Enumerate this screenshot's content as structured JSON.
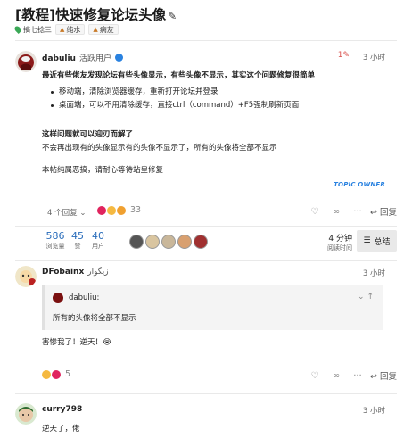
{
  "topic": {
    "title": "[教程]快速修复论坛头像",
    "category": "搞七捻三",
    "tags": [
      "纯水",
      "病友"
    ]
  },
  "posts": [
    {
      "username": "dabuliu",
      "user_title": "活跃用户",
      "time": "3 小时",
      "heading": "最近有些佬友发现论坛有些头像显示，有些头像不显示，其实这个问题修复很简单",
      "bullets": [
        "移动端，清除浏览器缓存，重新打开论坛并登录",
        "桌面端，可以不用清除缓存，直接ctrl（command）+F5强制刷新页面"
      ],
      "subheading": "这样问题就可以迎刃而解了",
      "para1": "不会再出现有的头像显示有的头像不显示了，所有的头像将全部不显示",
      "para2": "本帖纯属恶搞，请耐心等待站皇修复",
      "badge": "TOPIC OWNER",
      "replies_label": "4 个回复",
      "reaction_count": "33",
      "reply_label": "回复"
    },
    {
      "username": "DFobainx",
      "display_name": "زیگوار",
      "time": "3 小时",
      "quote_user": "dabuliu:",
      "quote_text": "所有的头像将全部不显示",
      "text": "害惨我了！逆天！😭",
      "reaction_count": "5",
      "reply_label": "回复"
    },
    {
      "username": "curry798",
      "time": "3 小时",
      "text": "逆天了，佬"
    }
  ],
  "summary": {
    "views": "586",
    "views_label": "浏览量",
    "likes": "45",
    "likes_label": "赞",
    "users": "40",
    "users_label": "用户",
    "read_time": "4 分钟",
    "read_time_label": "阅读时间",
    "button": "总结"
  },
  "icons": {
    "edit": "pencil-icon",
    "like": "heart-icon",
    "link": "link-icon",
    "more": "more-icon",
    "reply": "reply-icon",
    "summary": "summary-icon"
  },
  "colors": {
    "accent": "#2a82e0",
    "stat_number": "#2a6dbb",
    "category": "#3aa856"
  }
}
